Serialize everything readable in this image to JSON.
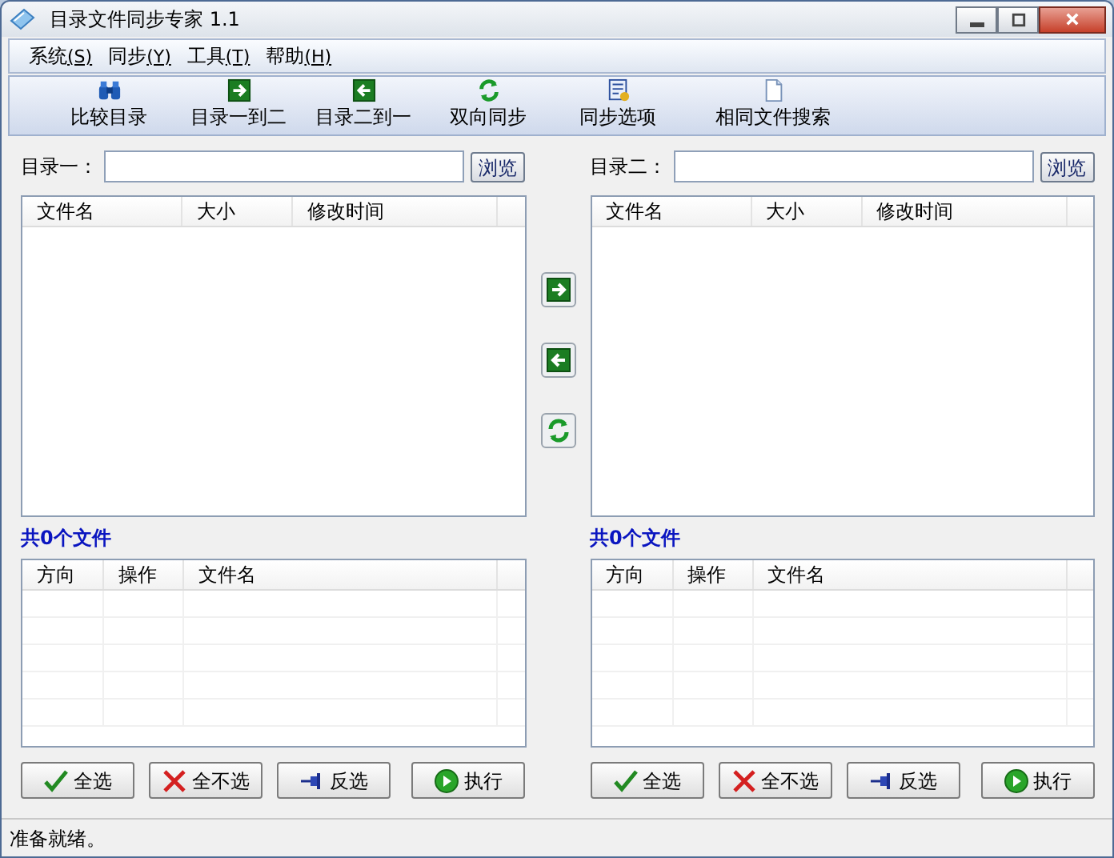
{
  "window": {
    "title": "目录文件同步专家 1.1"
  },
  "menu": [
    {
      "label": "系统",
      "accel": "(S)"
    },
    {
      "label": "同步",
      "accel": "(Y)"
    },
    {
      "label": "工具",
      "accel": "(T)"
    },
    {
      "label": "帮助",
      "accel": "(H)"
    }
  ],
  "toolbar": [
    {
      "label": "比较目录",
      "kind": "compare"
    },
    {
      "label": "目录一到二",
      "kind": "right"
    },
    {
      "label": "目录二到一",
      "kind": "left"
    },
    {
      "label": "双向同步",
      "kind": "sync"
    },
    {
      "label": "同步选项",
      "kind": "options"
    },
    {
      "label": "相同文件搜索",
      "kind": "file"
    }
  ],
  "panels": [
    {
      "dir_label": "目录一：",
      "browse": "浏览",
      "file_columns": [
        "文件名",
        "大小",
        "修改时间"
      ],
      "count": "共0个文件",
      "op_columns": [
        "方向",
        "操作",
        "文件名"
      ],
      "buttons": [
        {
          "label": "全选",
          "kind": "check"
        },
        {
          "label": "全不选",
          "kind": "cross"
        },
        {
          "label": "反选",
          "kind": "pin"
        },
        {
          "label": "执行",
          "kind": "run"
        }
      ]
    },
    {
      "dir_label": "目录二：",
      "browse": "浏览",
      "file_columns": [
        "文件名",
        "大小",
        "修改时间"
      ],
      "count": "共0个文件",
      "op_columns": [
        "方向",
        "操作",
        "文件名"
      ],
      "buttons": [
        {
          "label": "全选",
          "kind": "check"
        },
        {
          "label": "全不选",
          "kind": "cross"
        },
        {
          "label": "反选",
          "kind": "pin"
        },
        {
          "label": "执行",
          "kind": "run"
        }
      ]
    }
  ],
  "transfer_buttons": [
    {
      "kind": "right"
    },
    {
      "kind": "left"
    },
    {
      "kind": "sync"
    }
  ],
  "status_bar": "准备就绪。"
}
